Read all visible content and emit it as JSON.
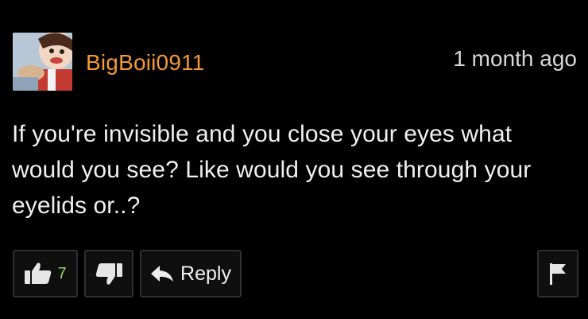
{
  "comment": {
    "username": "BigBoii0911",
    "timestamp": "1 month ago",
    "text": "If you're invisible and you close your eyes what would you see? Like would you see through your eyelids or..?"
  },
  "actions": {
    "like_count": "7",
    "reply_label": "Reply"
  },
  "colors": {
    "background": "#000000",
    "username": "#f29a37",
    "like_count": "#a6d05a",
    "button_border": "#2f2f2f"
  },
  "icons": {
    "like": "thumbs-up-icon",
    "dislike": "thumbs-down-icon",
    "reply": "reply-arrow-icon",
    "flag": "flag-icon"
  }
}
